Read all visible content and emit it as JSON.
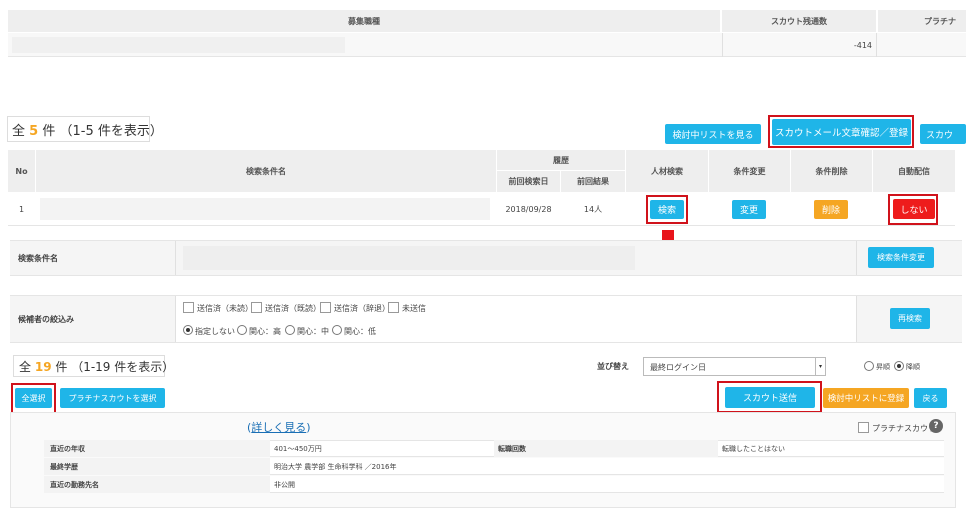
{
  "top_table": {
    "col_job": "募集職種",
    "col_scout_remaining": "スカウト残通数",
    "col_platinum": "プラチナ",
    "scout_remaining_value": "-414"
  },
  "list_bar": {
    "total_prefix": "全",
    "total_count": "5",
    "total_suffix": "件 （1-5 件を表示）",
    "review_list_button": "検討中リストを見る",
    "scout_mail_button": "スカウトメール文章確認／登録",
    "scout_button_partial": "スカウ"
  },
  "search_table": {
    "headers": {
      "no": "No",
      "name": "検索条件名",
      "history": "履歴",
      "last_search_date": "前回検索日",
      "last_result": "前回結果",
      "talent_search": "人材検索",
      "change_condition": "条件変更",
      "delete_condition": "条件削除",
      "auto_delivery": "自動配信"
    },
    "rows": [
      {
        "no": "1",
        "last_search_date": "2018/09/28",
        "last_result": "14人",
        "search_btn": "検索",
        "change_btn": "変更",
        "delete_btn": "削除",
        "auto_btn": "しない"
      }
    ]
  },
  "filter_panel": {
    "search_condition_label": "検索条件名",
    "change_condition_button": "検索条件変更",
    "narrow_label": "候補者の絞込み",
    "checkboxes": [
      "送信済（未読）",
      "送信済（既読）",
      "送信済（辞退）",
      "未送信"
    ],
    "radios": [
      "指定しない",
      "関心：高",
      "関心：中",
      "関心：低"
    ],
    "radio_selected": 0,
    "research_button": "再検索"
  },
  "result_bar": {
    "total_prefix": "全",
    "total_count": "19",
    "total_suffix": "件 （1-19 件を表示）",
    "sort_label": "並び替え",
    "sort_value": "最終ログイン日",
    "order_options": [
      "昇順",
      "降順"
    ],
    "order_selected": 1
  },
  "action_bar": {
    "select_all": "全選択",
    "select_platinum": "プラチナスカウトを選択",
    "send_scout": "スカウト送信",
    "add_review": "検討中リストに登録",
    "back": "戻る"
  },
  "candidate": {
    "detail_link": "詳しく見る",
    "platinum_checkbox": "プラチナスカウト",
    "help": "?",
    "rows": [
      {
        "label": "直近の年収",
        "value": "401～450万円",
        "label2": "転職回数",
        "value2": "転職したことはない"
      },
      {
        "label": "最終学歴",
        "value": "明治大学 農学部 生命科学科 ／2016年"
      },
      {
        "label": "直近の勤務先名",
        "value": "非公開"
      }
    ]
  },
  "colors": {
    "accent": "#1fb5e8",
    "warning": "#f5a623",
    "danger": "#ee1c1c",
    "highlight_box": "#d0121b"
  },
  "icons": {
    "arrow": "down-arrow-icon",
    "dropdown": "chevron-down-icon",
    "help": "help-icon"
  }
}
